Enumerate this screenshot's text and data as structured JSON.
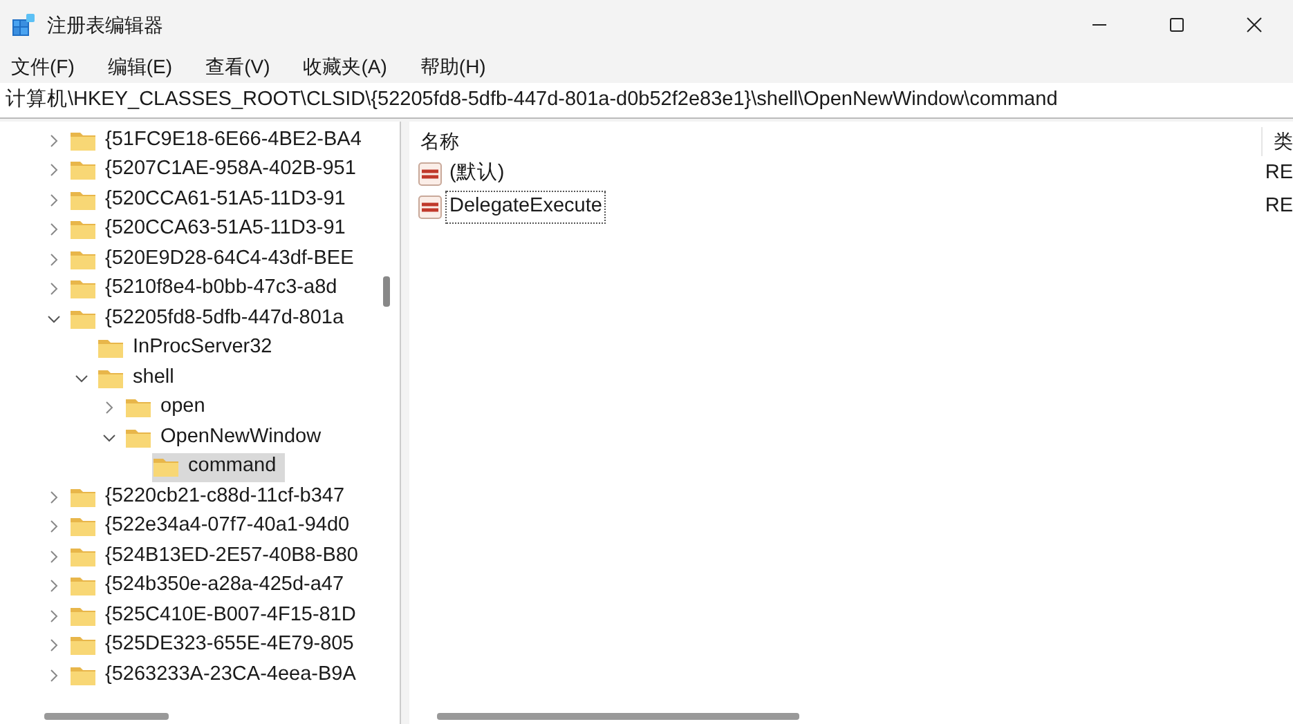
{
  "window": {
    "title": "注册表编辑器"
  },
  "menu": [
    "文件(F)",
    "编辑(E)",
    "查看(V)",
    "收藏夹(A)",
    "帮助(H)"
  ],
  "address": "计算机\\HKEY_CLASSES_ROOT\\CLSID\\{52205fd8-5dfb-447d-801a-d0b52f2e83e1}\\shell\\OpenNewWindow\\command",
  "tree": [
    {
      "label": "{51FC9E18-6E66-4BE2-BA4",
      "expanded": false,
      "selected": false
    },
    {
      "label": "{5207C1AE-958A-402B-951",
      "expanded": false,
      "selected": false
    },
    {
      "label": "{520CCA61-51A5-11D3-91",
      "expanded": false,
      "selected": false
    },
    {
      "label": "{520CCA63-51A5-11D3-91",
      "expanded": false,
      "selected": false
    },
    {
      "label": "{520E9D28-64C4-43df-BEE",
      "expanded": false,
      "selected": false
    },
    {
      "label": "{5210f8e4-b0bb-47c3-a8d",
      "expanded": false,
      "selected": false
    },
    {
      "label": "{52205fd8-5dfb-447d-801a",
      "expanded": true,
      "selected": false,
      "children": [
        {
          "label": "InProcServer32",
          "selected": false
        },
        {
          "label": "shell",
          "expanded": true,
          "selected": false,
          "children": [
            {
              "label": "open",
              "expanded": false,
              "selected": false
            },
            {
              "label": "OpenNewWindow",
              "expanded": true,
              "selected": false,
              "children": [
                {
                  "label": "command",
                  "selected": true
                }
              ]
            }
          ]
        }
      ]
    },
    {
      "label": "{5220cb21-c88d-11cf-b347",
      "expanded": false,
      "selected": false
    },
    {
      "label": "{522e34a4-07f7-40a1-94d0",
      "expanded": false,
      "selected": false
    },
    {
      "label": "{524B13ED-2E57-40B8-B80",
      "expanded": false,
      "selected": false
    },
    {
      "label": "{524b350e-a28a-425d-a47",
      "expanded": false,
      "selected": false
    },
    {
      "label": "{525C410E-B007-4F15-81D",
      "expanded": false,
      "selected": false
    },
    {
      "label": "{525DE323-655E-4E79-805",
      "expanded": false,
      "selected": false
    },
    {
      "label": "{5263233A-23CA-4eea-B9A",
      "expanded": false,
      "selected": false
    }
  ],
  "values": {
    "columns": [
      "名称",
      "类"
    ],
    "rows": [
      {
        "name": "(默认)",
        "column_2": "RE",
        "focused": false
      },
      {
        "name": "DelegateExecute",
        "column_2": "RE",
        "focused": true
      }
    ]
  }
}
